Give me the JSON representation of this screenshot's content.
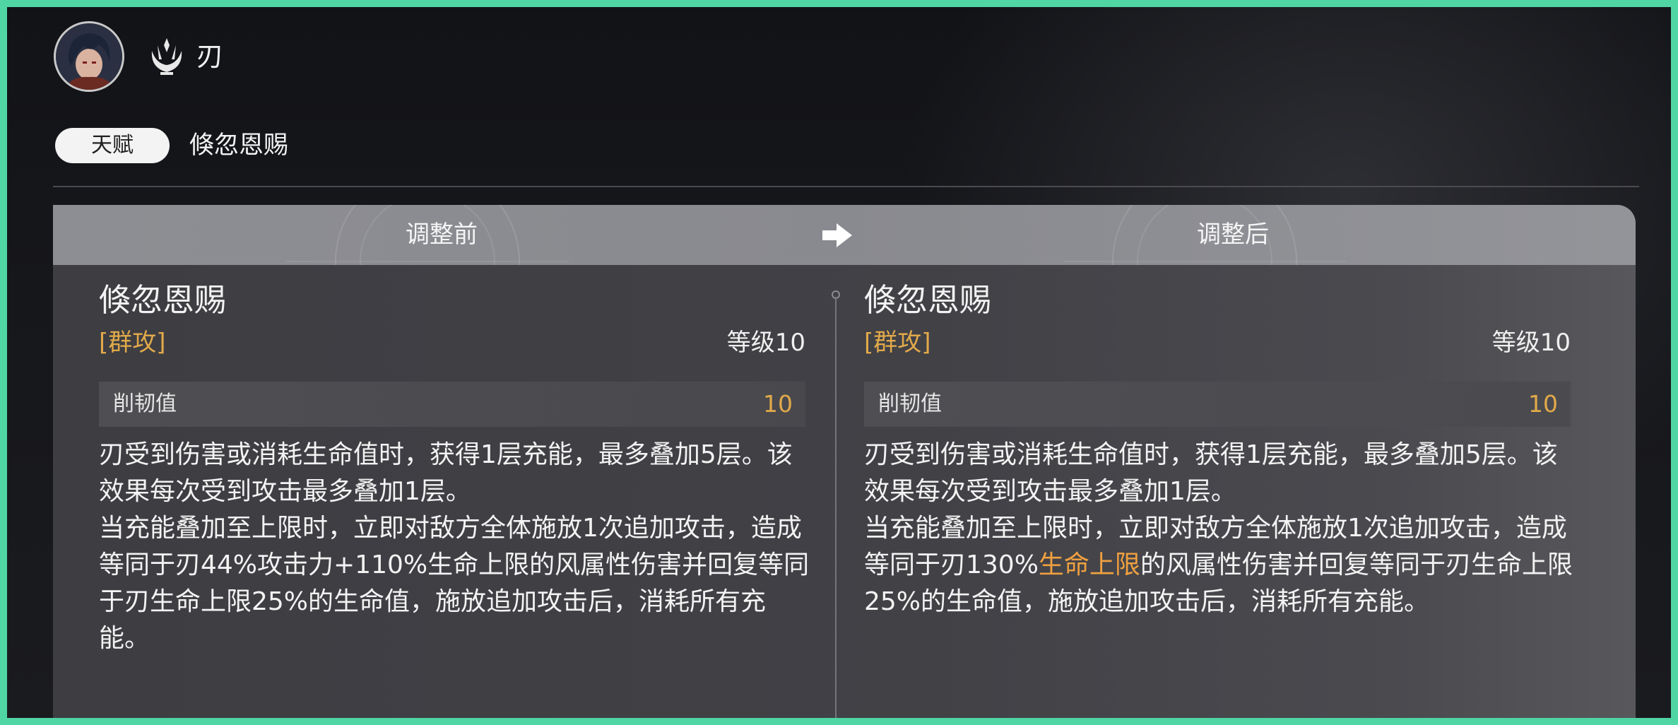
{
  "character": {
    "name": "刃",
    "avatar_icon": "character-portrait",
    "path_icon": "destruction-path-icon"
  },
  "talent": {
    "badge": "天赋",
    "name": "倏忽恩赐"
  },
  "comparison": {
    "before_label": "调整前",
    "after_label": "调整后",
    "arrow_icon": "arrow-right-icon",
    "before": {
      "title": "倏忽恩赐",
      "tag": "[群攻]",
      "level": "等级10",
      "toughness_label": "削韧值",
      "toughness_value": "10",
      "desc_line1": "刃受到伤害或消耗生命值时，获得1层充能，最多叠加5层。该效果每次受到攻击最多叠加1层。",
      "desc_line2": "当充能叠加至上限时，立即对敌方全体施放1次追加攻击，造成等同于刃44%攻击力+110%生命上限的风属性伤害并回复等同于刃生命上限25%的生命值，施放追加攻击后，消耗所有充能。"
    },
    "after": {
      "title": "倏忽恩赐",
      "tag": "[群攻]",
      "level": "等级10",
      "toughness_label": "削韧值",
      "toughness_value": "10",
      "desc_line1": "刃受到伤害或消耗生命值时，获得1层充能，最多叠加5层。该效果每次受到攻击最多叠加1层。",
      "desc_line2_a": "当充能叠加至上限时，立即对敌方全体施放1次追加攻击，造成等同于刃130%",
      "desc_line2_highlight": "生命上限",
      "desc_line2_b": "的风属性伤害并回复等同于刃生命上限25%的生命值，施放追加攻击后，消耗所有充能。"
    }
  },
  "colors": {
    "accent_gold": "#e1a94a",
    "highlight_orange": "#f0a040",
    "frame_green": "#4fd6a4"
  }
}
